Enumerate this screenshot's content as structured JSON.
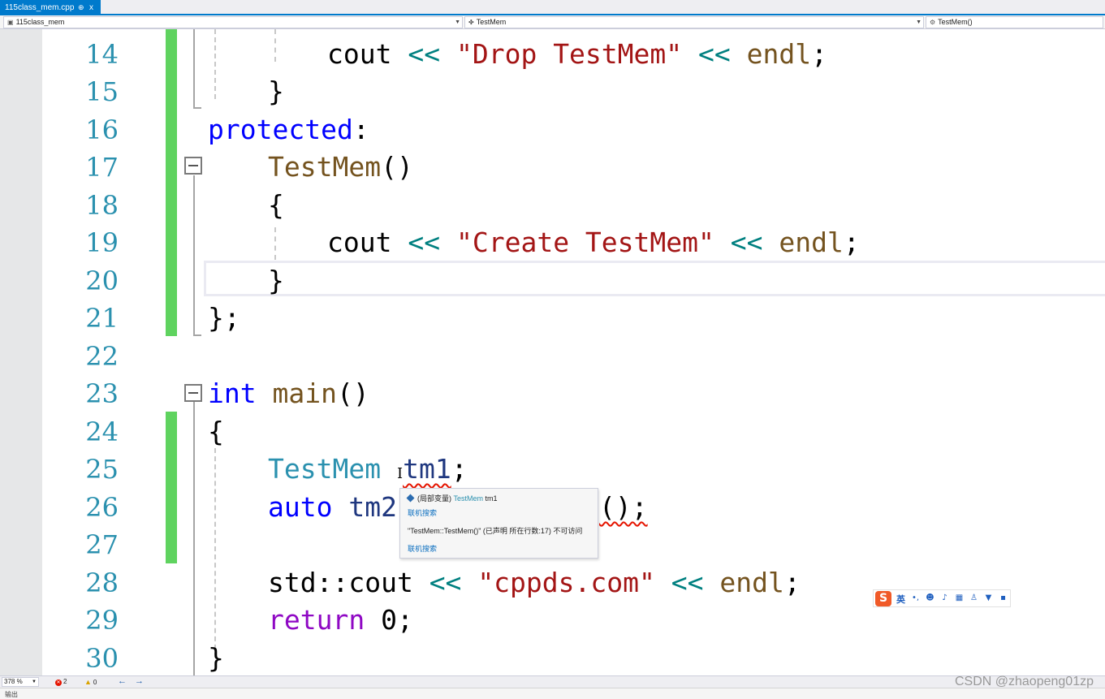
{
  "tab": {
    "title": "115class_mem.cpp",
    "pin_glyph": "⊕",
    "close_glyph": "x"
  },
  "navbar": {
    "project": "115class_mem",
    "scope": "TestMem",
    "member": "TestMem()"
  },
  "editor": {
    "line_numbers": [
      "14",
      "15",
      "16",
      "17",
      "18",
      "19",
      "20",
      "21",
      "22",
      "23",
      "24",
      "25",
      "26",
      "27",
      "28",
      "29",
      "30"
    ],
    "lines": {
      "l14": {
        "a": "cout",
        "op1": "<<",
        "s": "\"Drop TestMem\"",
        "op2": "<<",
        "b": "endl",
        "c": ";"
      },
      "l15": {
        "a": "}"
      },
      "l16": {
        "kw": "protected",
        "c": ":"
      },
      "l17": {
        "fn": "TestMem",
        "c": "()"
      },
      "l18": {
        "a": "{"
      },
      "l19": {
        "a": "cout",
        "op1": "<<",
        "s": "\"Create TestMem\"",
        "op2": "<<",
        "b": "endl",
        "c": ";"
      },
      "l20": {
        "a": "}"
      },
      "l21": {
        "a": "};"
      },
      "l23": {
        "kw": "int",
        "fn": "main",
        "c": "()"
      },
      "l24": {
        "a": "{"
      },
      "l25": {
        "typ": "TestMem",
        "var": "tm1",
        "c": ";"
      },
      "l26": {
        "kw": "auto",
        "var": "tm2",
        "c": "();"
      },
      "l28": {
        "a": "std::cout",
        "op1": "<<",
        "s": "\"cppds.com\"",
        "op2": "<<",
        "b": "endl",
        "c": ";"
      },
      "l29": {
        "kw": "return",
        "n": "0",
        "c": ";"
      },
      "l30": {
        "a": "}"
      }
    }
  },
  "tooltip": {
    "kind": "(局部变量)",
    "type": "TestMem",
    "name": "tm1",
    "search1": "联机搜索",
    "error": "\"TestMem::TestMem()\" (已声明 所在行数:17) 不可访问",
    "search2": "联机搜索"
  },
  "ime": {
    "logo": "S",
    "lang": "英"
  },
  "statusbar": {
    "zoom": "378 %",
    "errors": "2",
    "warnings": "0",
    "back": "←",
    "forward": "→"
  },
  "bottom": {
    "label": "输出"
  },
  "watermark": "CSDN @zhaopeng01zp",
  "colors": {
    "accent": "#007acc",
    "keyword": "#0000ff",
    "control_keyword": "#8f08c4",
    "type": "#2b91af",
    "function": "#74531f",
    "string": "#a31515",
    "operator": "#008080",
    "change_bar": "#5fd35f",
    "error": "#e51400"
  }
}
